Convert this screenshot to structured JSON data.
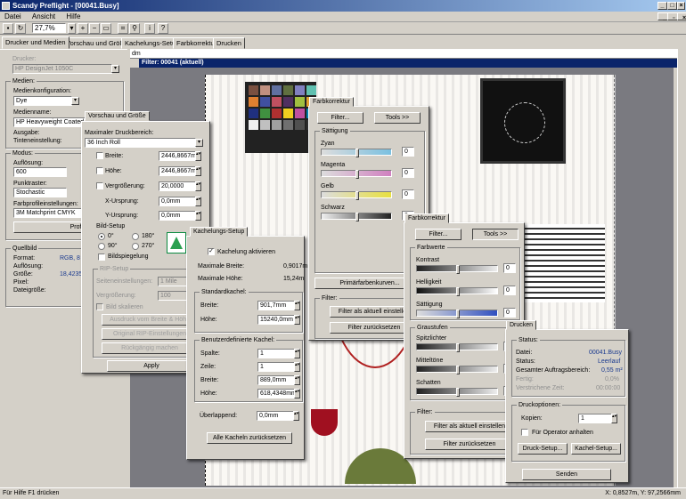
{
  "window": {
    "title": "Scandy Preflight - [00041.Busy]"
  },
  "menu": [
    "Datei",
    "Ansicht",
    "Hilfe"
  ],
  "toolbar": {
    "zoom": "27,7%"
  },
  "main_tabs": [
    "Drucker und Medien",
    "Vorschau und Größe",
    "Kachelungs-Setup",
    "Farbkorrektur",
    "Drucken"
  ],
  "ruler": {
    "unit": "dm"
  },
  "filter_header": "Filter: 00041 (aktuell)",
  "left": {
    "printer_label": "Drucker:",
    "printer_value": "HP DesignJet 1050C",
    "media_group": "Medien:",
    "media_config_label": "Medienkonfiguration:",
    "media_config_value": "Dye",
    "media_name_label": "Medienname:",
    "media_name_value": "HP Heavyweight Coated Paper",
    "output_label": "Ausgabe:",
    "ink_label": "Tinteneinstellung:",
    "mode_group": "Modus:",
    "resolution_label": "Auflösung:",
    "resolution_value": "600",
    "dither_label": "Punktraster:",
    "dither_value": "Stochastic",
    "profile_label": "Farbprofileinstellungen:",
    "profile_value": "3M Matchprint CMYK",
    "profile_button": "Profile ändern...",
    "source_group": "Quellbild",
    "format_label": "Format:",
    "format_value": "RGB, 8 Bit",
    "res2_label": "Auflösung:",
    "size_label": "Größe:",
    "size_value": "18,4235cm x",
    "pixel_label": "Pixel:",
    "filesize_label": "Dateigröße:"
  },
  "preview": {
    "tab": "Vorschau und Größe",
    "max_area_label": "Maximaler Druckbereich:",
    "max_area_value": "36 Inch Roll",
    "width_label": "Breite:",
    "width_value": "2446,8667m",
    "height_label": "Höhe:",
    "height_value": "2446,8667m",
    "enlarge_label": "Vergrößerung:",
    "enlarge_value": "20,0000",
    "xorigin_label": "X-Ursprung:",
    "xorigin_value": "0,0mm",
    "yorigin_label": "Y-Ursprung:",
    "yorigin_value": "0,0mm",
    "image_setup": "Bild-Setup",
    "rot0": "0°",
    "rot180": "180°",
    "rot90": "90°",
    "rot270": "270°",
    "mirror": "Bildspiegelung",
    "rip_group": "RIP-Setup",
    "rip_setting_label": "Seiteneinstellungen:",
    "rip_setting_value": "1 Mile",
    "magnify_label": "Vergrößerung:",
    "magnify_value": "100",
    "image_scale": "Bild skalieren",
    "btn_fit": "Ausdruck vom Breite & Höhe",
    "btn_original": "Original RIP-Einstellungen",
    "btn_undo": "Rückgängig machen",
    "apply": "Apply"
  },
  "tiling": {
    "tab": "Kachelungs-Setup",
    "enable": "Kachelung aktivieren",
    "max_width_label": "Maximale Breite:",
    "max_width_value": "0,9017m",
    "max_height_label": "Maximale Höhe:",
    "max_height_value": "15,24m",
    "std_group": "Standardkachel:",
    "std_width_label": "Breite:",
    "std_width_value": "901,7mm",
    "std_height_label": "Höhe:",
    "std_height_value": "15240,0mm",
    "user_group": "Benutzerdefinierte Kachel:",
    "col_label": "Spalte:",
    "col_value": "1",
    "row_label": "Zeile:",
    "row_value": "1",
    "uw_label": "Breite:",
    "uw_value": "889,0mm",
    "uh_label": "Höhe:",
    "uh_value": "618,4348mm",
    "overlap_label": "Überlappend:",
    "overlap_value": "0,0mm",
    "reset": "Alle Kacheln zurücksetzen"
  },
  "color1": {
    "tab": "Farbkorrektur",
    "filter_btn": "Filter...",
    "tools_btn": "Tools >>",
    "sat_group": "Sättigung",
    "cyan": "Zyan",
    "cyan_val": "0",
    "magenta": "Magenta",
    "magenta_val": "0",
    "yellow": "Gelb",
    "yellow_val": "0",
    "black": "Schwarz",
    "black_val": "0",
    "primary_btn": "Primärfarbenkurven...",
    "filter_group": "Filter:",
    "save_filter": "Filter als aktuell einstellen",
    "reset_filter": "Filter zurücksetzen"
  },
  "color2": {
    "tab": "Farbkorrektur",
    "filter_btn": "Filter...",
    "tools_btn": "Tools >>",
    "color_group": "Farbwerte",
    "contrast": "Kontrast",
    "contrast_val": "0",
    "brightness": "Helligkeit",
    "brightness_val": "0",
    "saturation": "Sättigung",
    "saturation_val": "0",
    "gray_group": "Graustufen",
    "highlights": "Spitzlichter",
    "highlights_val": "0",
    "midtones": "Mitteltöne",
    "midtones_val": "0",
    "shadows": "Schatten",
    "shadows_val": "0",
    "filter_group": "Filter:",
    "save_filter": "Filter als aktuell einstellen",
    "reset_filter": "Filter zurücksetzen"
  },
  "print": {
    "tab": "Drucken",
    "status_group": "Status:",
    "file_label": "Datei:",
    "file_value": "00041.Busy",
    "state_label": "Status:",
    "state_value": "Leerlauf",
    "total_label": "Gesamter Auftragsbereich:",
    "total_value": "0,55 m²",
    "done_label": "Fertig:",
    "done_value": "0,0%",
    "elapsed_label": "Verstrichene Zeit:",
    "elapsed_value": "00:00:00",
    "options_group": "Druckoptionen:",
    "copies_label": "Kopien:",
    "copies_value": "1",
    "operator_stop": "Für Operator anhalten",
    "print_setup": "Druck-Setup...",
    "tile_setup": "Kachel-Setup...",
    "send": "Senden"
  },
  "status": {
    "left": "Für Hilfe F1 drücken",
    "right": "X: 0,8527m, Y: 97,2566mm"
  },
  "colors": {
    "title_start": "#0a246a",
    "title_end": "#a6caf0",
    "face": "#d4d0c8",
    "canvas": "#7a7a80"
  }
}
